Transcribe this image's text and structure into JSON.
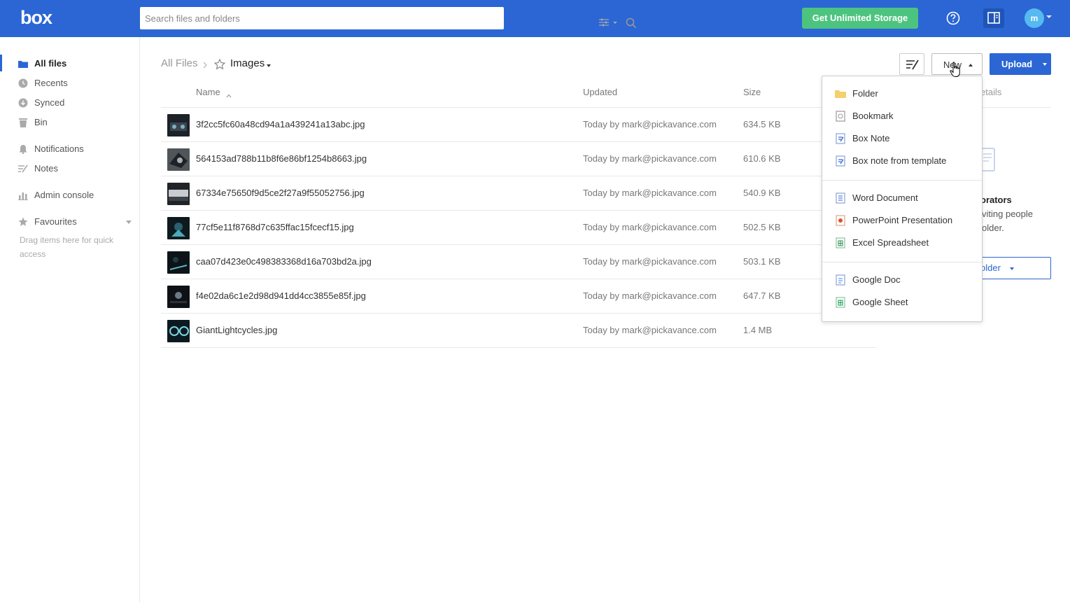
{
  "header": {
    "logo": "box",
    "search_placeholder": "Search files and folders",
    "upgrade_label": "Get Unlimited Storage",
    "avatar_initial": "m",
    "brand_color": "#2b66d4",
    "upgrade_color": "#4cc47f"
  },
  "sidebar": {
    "items": [
      {
        "label": "All files",
        "icon": "folder-icon",
        "active": true
      },
      {
        "label": "Recents",
        "icon": "clock-icon"
      },
      {
        "label": "Synced",
        "icon": "sync-icon"
      },
      {
        "label": "Bin",
        "icon": "trash-icon"
      },
      {
        "label": "Notifications",
        "icon": "bell-icon"
      },
      {
        "label": "Notes",
        "icon": "notes-icon"
      },
      {
        "label": "Admin console",
        "icon": "bar-chart-icon"
      },
      {
        "label": "Favourites",
        "icon": "star-icon"
      }
    ],
    "drag_hint": "Drag items here for quick access"
  },
  "breadcrumb": {
    "root": "All Files",
    "current": "Images"
  },
  "toolbar": {
    "new_label": "New",
    "upload_label": "Upload"
  },
  "table": {
    "columns": {
      "name": "Name",
      "updated": "Updated",
      "size": "Size"
    },
    "rows": [
      {
        "name": "3f2cc5fc60a48cd94a1a439241a13abc.jpg",
        "updated": "Today by mark@pickavance.com",
        "size": "634.5 KB"
      },
      {
        "name": "564153ad788b11b8f6e86bf1254b8663.jpg",
        "updated": "Today by mark@pickavance.com",
        "size": "610.6 KB"
      },
      {
        "name": "67334e75650f9d5ce2f27a9f55052756.jpg",
        "updated": "Today by mark@pickavance.com",
        "size": "540.9 KB"
      },
      {
        "name": "77cf5e11f8768d7c635ffac15fcecf15.jpg",
        "updated": "Today by mark@pickavance.com",
        "size": "502.5 KB"
      },
      {
        "name": "caa07d423e0c498383368d16a703bd2a.jpg",
        "updated": "Today by mark@pickavance.com",
        "size": "503.1 KB"
      },
      {
        "name": "f4e02da6c1e2d98d941dd4cc3855e85f.jpg",
        "updated": "Today by mark@pickavance.com",
        "size": "647.7 KB"
      },
      {
        "name": "GiantLightcycles.jpg",
        "updated": "Today by mark@pickavance.com",
        "size": "1.4 MB"
      }
    ]
  },
  "details": {
    "tab_partial": "etails",
    "collab_title_partial": "orators",
    "collab_desc_line1_partial": "viting people",
    "collab_desc_line2_partial": "older.",
    "folder_button_partial": "older"
  },
  "new_menu": {
    "group1": [
      {
        "label": "Folder",
        "icon": "folder-icon"
      },
      {
        "label": "Bookmark",
        "icon": "bookmark-icon"
      },
      {
        "label": "Box Note",
        "icon": "box-note-icon"
      },
      {
        "label": "Box note from template",
        "icon": "box-note-template-icon"
      }
    ],
    "group2": [
      {
        "label": "Word Document",
        "icon": "word-doc-icon"
      },
      {
        "label": "PowerPoint Presentation",
        "icon": "powerpoint-icon"
      },
      {
        "label": "Excel Spreadsheet",
        "icon": "excel-icon"
      }
    ],
    "group3": [
      {
        "label": "Google Doc",
        "icon": "google-doc-icon"
      },
      {
        "label": "Google Sheet",
        "icon": "google-sheet-icon"
      }
    ]
  }
}
